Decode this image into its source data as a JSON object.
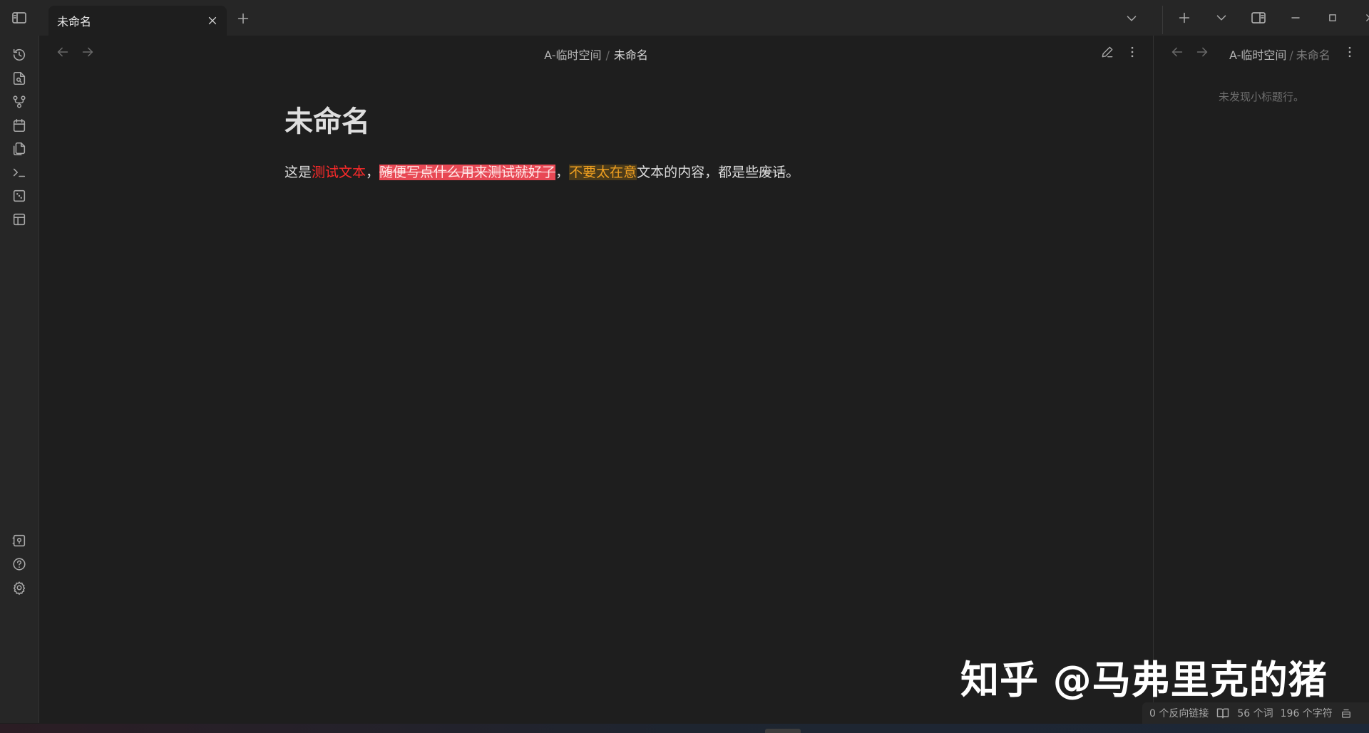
{
  "titlebar": {
    "tab_title": "未命名"
  },
  "main": {
    "breadcrumb_folder": "A-临时空间",
    "breadcrumb_sep": "/",
    "breadcrumb_file": "未命名",
    "doc_title": "未命名",
    "body": {
      "part1": "这是",
      "red_text": "测试文本",
      "comma1": "，",
      "highlight_red": "随便写点什么用来测试就好了",
      "comma2": "，",
      "highlight_yellow": "不要太在意",
      "part2": "文本的内容，都是些",
      "strike_text": "废话",
      "period": "。"
    }
  },
  "right_pane": {
    "breadcrumb_folder": "A-临时空间",
    "breadcrumb_sep": "/",
    "breadcrumb_file": "未命名",
    "empty_message": "未发现小标题行。"
  },
  "status": {
    "backlinks": "0 个反向链接",
    "words": "56 个词",
    "chars": "196 个字符"
  },
  "watermark": "知乎 @马弗里克的猪",
  "icons": [
    "sidebar-toggle-icon",
    "close-icon",
    "plus-icon",
    "chevron-down-icon",
    "split-view-icon",
    "minimize-icon",
    "maximize-icon",
    "open-recent-icon",
    "file-search-icon",
    "graph-icon",
    "calendar-icon",
    "copy-icon",
    "terminal-icon",
    "dice-icon",
    "layout-icon",
    "vault-icon",
    "help-icon",
    "settings-icon",
    "arrow-left-icon",
    "arrow-right-icon",
    "pencil-icon",
    "more-vertical-icon",
    "book-open-icon",
    "status-edit-icon"
  ],
  "colors": {
    "background": "#1e1e1e",
    "red_text": "#ff2a2a",
    "highlight_red": "#e84854",
    "highlight_yellow_text": "#f0a020"
  }
}
